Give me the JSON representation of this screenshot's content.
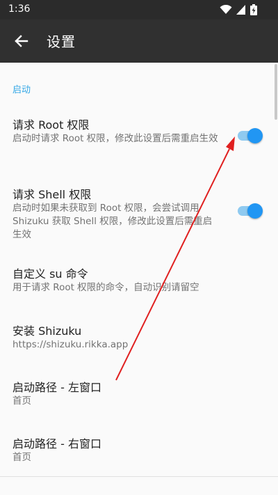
{
  "status_bar": {
    "time": "1:36",
    "icons": [
      "wifi-icon",
      "signal-icon",
      "battery-icon"
    ]
  },
  "app_bar": {
    "title": "设置",
    "back_icon": "arrow-left-icon"
  },
  "section": {
    "header": "启动"
  },
  "preferences": [
    {
      "title": "请求 Root 权限",
      "summary": "启动时请求 Root 权限，修改此设置后需重启生效",
      "toggle_on": true
    },
    {
      "title": "请求 Shell 权限",
      "summary": "启动时如果未获取到 Root 权限，会尝试调用 Shizuku 获取 Shell 权限，修改此设置后需重启生效",
      "toggle_on": true
    },
    {
      "title": "自定义 su 命令",
      "summary": "用于请求 Root 权限的命令，自动识别请留空"
    },
    {
      "title": "安装 Shizuku",
      "summary": "https://shizuku.rikka.app"
    },
    {
      "title": "启动路径 - 左窗口",
      "summary": "首页"
    },
    {
      "title": "启动路径 - 右窗口",
      "summary": "首页"
    }
  ],
  "colors": {
    "accent": "#2196f3",
    "section_header": "#33a7e6",
    "app_bar": "#303030",
    "status_bar": "#2b2b2b",
    "annotation_arrow": "#e02020"
  }
}
